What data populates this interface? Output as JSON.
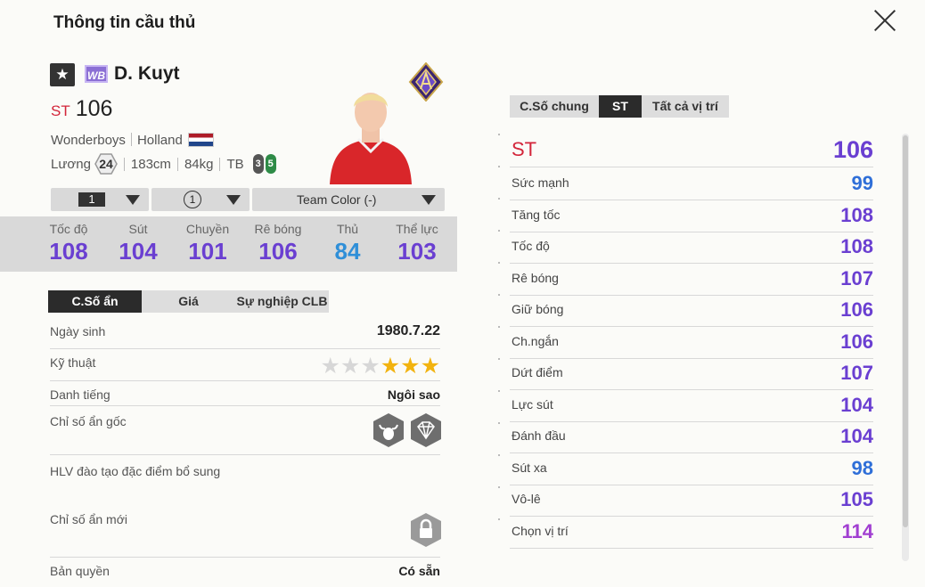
{
  "window": {
    "title": "Thông tin cầu thủ"
  },
  "player": {
    "name": "D. Kuyt",
    "season_badge": "WB",
    "position": "ST",
    "ovr": "106",
    "team": "Wonderboys",
    "nation": "Holland",
    "salary_label": "Lương",
    "salary": "24",
    "height": "183cm",
    "weight": "84kg",
    "body_type": "TB",
    "left_foot": "3",
    "right_foot": "5"
  },
  "selectors": {
    "level": "1",
    "grade": "1",
    "team_color": "Team Color (-)"
  },
  "summary_stats": [
    {
      "label": "Tốc độ",
      "value": "108",
      "color": "#6a3fd1"
    },
    {
      "label": "Sút",
      "value": "104",
      "color": "#6a3fd1"
    },
    {
      "label": "Chuyền",
      "value": "101",
      "color": "#6a3fd1"
    },
    {
      "label": "Rê bóng",
      "value": "106",
      "color": "#6a3fd1"
    },
    {
      "label": "Thủ",
      "value": "84",
      "color": "#2f8fd8"
    },
    {
      "label": "Thể lực",
      "value": "103",
      "color": "#6a3fd1"
    }
  ],
  "left_tabs": [
    {
      "label": "C.Số ẩn",
      "active": true
    },
    {
      "label": "Giá",
      "active": false
    },
    {
      "label": "Sự nghiệp CLB",
      "active": false
    }
  ],
  "details": {
    "birth_label": "Ngày sinh",
    "birth_value": "1980.7.22",
    "skill_label": "Kỹ thuật",
    "skill_stars": 3,
    "fame_label": "Danh tiếng",
    "fame_value": "Ngôi sao",
    "hidden_traits_label": "Chỉ số ẩn gốc",
    "trainer_label": "HLV đào tạo đặc điểm bổ sung",
    "new_traits_label": "Chỉ số ẩn mới",
    "license_label": "Bản quyền",
    "license_value": "Có sẵn"
  },
  "right_tabs": [
    {
      "label": "C.Số chung",
      "active": false
    },
    {
      "label": "ST",
      "active": true
    },
    {
      "label": "Tất cả vị trí",
      "active": false
    }
  ],
  "position_rating": {
    "label": "ST",
    "value": "106"
  },
  "attributes": [
    {
      "label": "Sức mạnh",
      "value": "99",
      "color": "#2f6fd8"
    },
    {
      "label": "Tăng tốc",
      "value": "108",
      "color": "#6a3fd1"
    },
    {
      "label": "Tốc độ",
      "value": "108",
      "color": "#6a3fd1"
    },
    {
      "label": "Rê bóng",
      "value": "107",
      "color": "#6a3fd1"
    },
    {
      "label": "Giữ bóng",
      "value": "106",
      "color": "#6a3fd1"
    },
    {
      "label": "Ch.ngắn",
      "value": "106",
      "color": "#6a3fd1"
    },
    {
      "label": "Dứt điểm",
      "value": "107",
      "color": "#6a3fd1"
    },
    {
      "label": "Lực sút",
      "value": "104",
      "color": "#6a3fd1"
    },
    {
      "label": "Đánh đầu",
      "value": "104",
      "color": "#6a3fd1"
    },
    {
      "label": "Sút xa",
      "value": "98",
      "color": "#2f6fd8"
    },
    {
      "label": "Vô-lê",
      "value": "105",
      "color": "#6a3fd1"
    },
    {
      "label": "Chọn vị trí",
      "value": "114",
      "color": "#a13fd1"
    }
  ]
}
